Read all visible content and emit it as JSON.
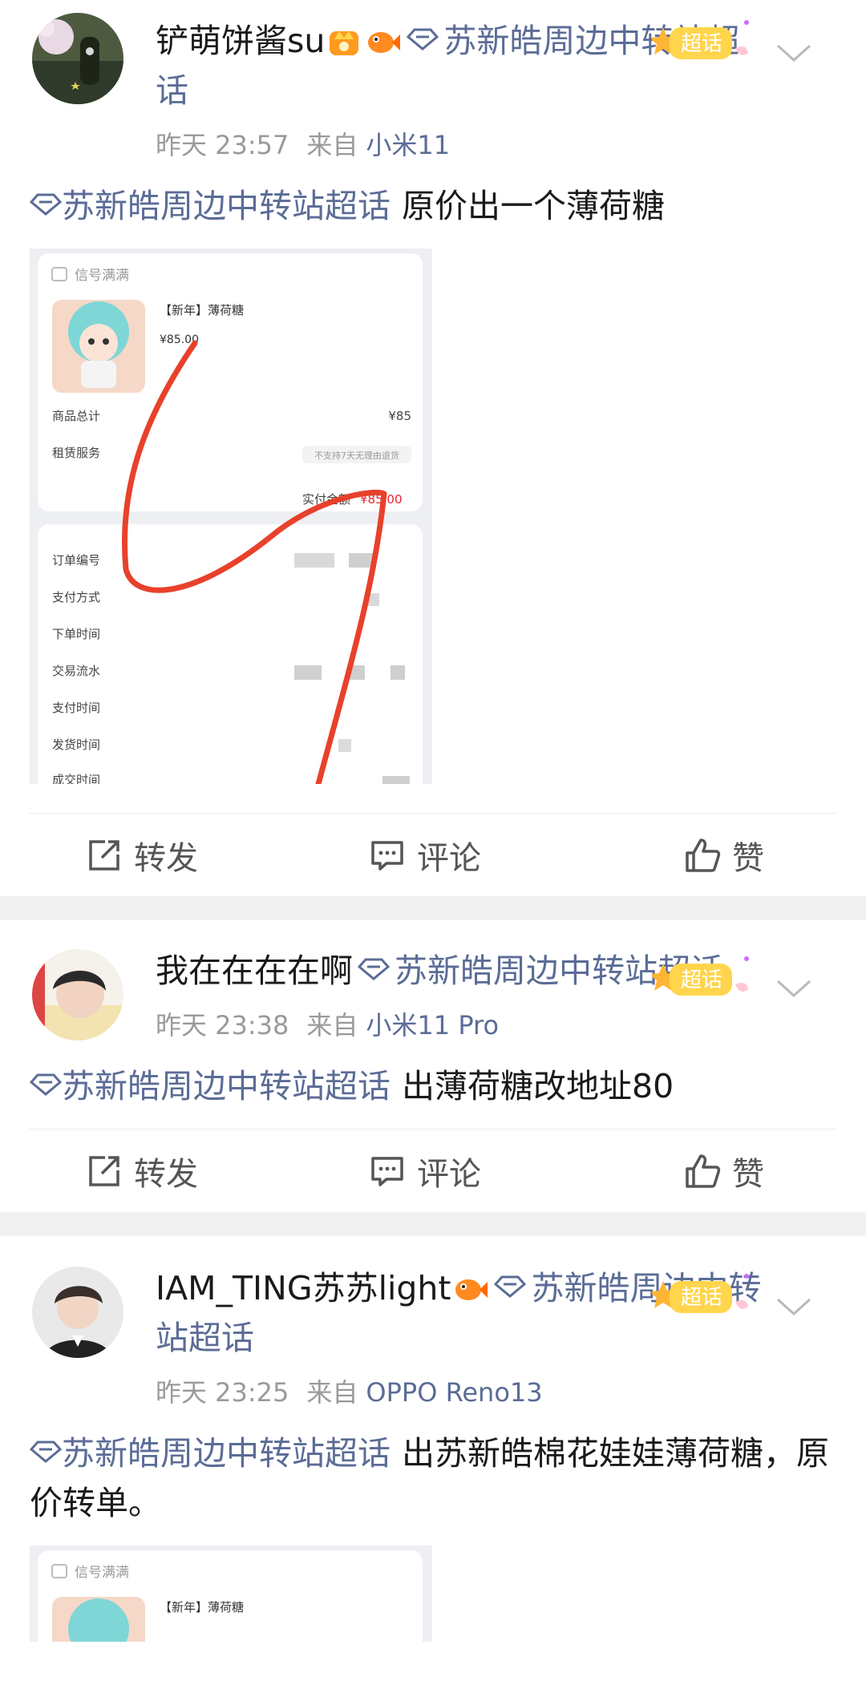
{
  "posts": [
    {
      "username": "铲萌饼酱su",
      "topic": "苏新皓周边中转站超话",
      "badge_text": "超话",
      "time": "昨天 23:57",
      "from_label": "来自",
      "source": "小米11",
      "content_topic": "苏新皓周边中转站超话",
      "content_text": "原价出一个薄荷糖",
      "image": {
        "shop_name": "信号满满",
        "product_title": "【新年】薄荷糖",
        "price": "¥85.00",
        "total_label": "商品总计",
        "total_value": "¥85",
        "service_label": "租赁服务",
        "service_value": "不支持7天无理由退货",
        "paid_label": "实付金额",
        "paid_value": "¥85.00",
        "order_labels": [
          "订单编号",
          "支付方式",
          "下单时间",
          "交易流水",
          "支付时间",
          "发货时间",
          "成交时间"
        ]
      }
    },
    {
      "username": "我在在在在啊",
      "topic": "苏新皓周边中转站超话",
      "badge_text": "超话",
      "time": "昨天 23:38",
      "from_label": "来自",
      "source": "小米11 Pro",
      "content_topic": "苏新皓周边中转站超话",
      "content_text": "出薄荷糖改地址80"
    },
    {
      "username": "IAM_TING苏苏light",
      "topic": "苏新皓周边中转站超话",
      "badge_text": "超话",
      "time": "昨天 23:25",
      "from_label": "来自",
      "source": "OPPO Reno13",
      "content_topic": "苏新皓周边中转站超话",
      "content_text": "出苏新皓棉花娃娃薄荷糖，原价转单。",
      "image": {
        "shop_name": "信号满满",
        "product_title": "【新年】薄荷糖"
      }
    }
  ],
  "actions": {
    "repost": "转发",
    "comment": "评论",
    "like": "赞"
  },
  "colors": {
    "link": "#5b6c96",
    "meta": "#9a9a9a",
    "divider": "#f1f1f1",
    "scribble": "#e8412b"
  },
  "icons": [
    "crown-badge-icon",
    "fish-badge-icon",
    "diamond-topic-icon",
    "chaohua-badge-icon",
    "chevron-down-icon",
    "repost-icon",
    "comment-icon",
    "like-icon"
  ]
}
